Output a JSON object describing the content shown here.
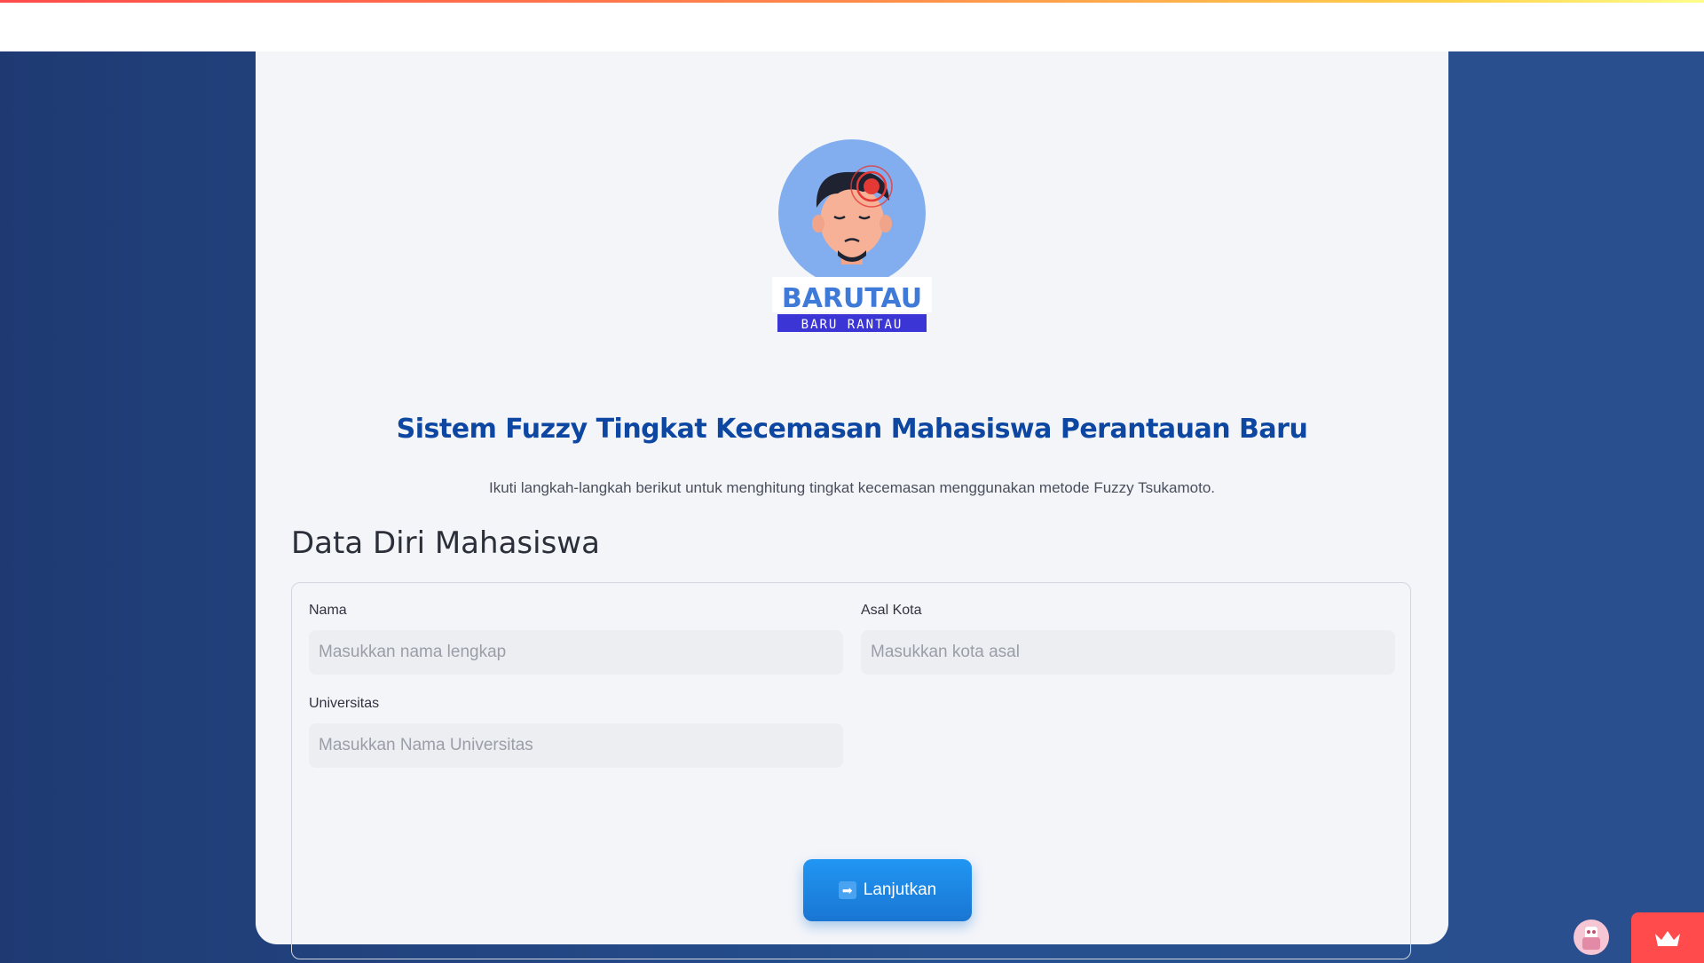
{
  "header": {
    "accent_colors": [
      "#ff4b4b",
      "#ffd24b"
    ]
  },
  "logo": {
    "name": "BARUTAU",
    "tagline": "BARU RANTAU"
  },
  "main": {
    "title": "Sistem Fuzzy Tingkat Kecemasan Mahasiswa Perantauan Baru",
    "subtitle": "Ikuti langkah-langkah berikut untuk menghitung tingkat kecemasan menggunakan metode Fuzzy Tsukamoto.",
    "section_title": "Data Diri Mahasiswa"
  },
  "form": {
    "nama": {
      "label": "Nama",
      "placeholder": "Masukkan nama lengkap",
      "value": ""
    },
    "asal_kota": {
      "label": "Asal Kota",
      "placeholder": "Masukkan kota asal",
      "value": ""
    },
    "universitas": {
      "label": "Universitas",
      "placeholder": "Masukkan Nama Universitas",
      "value": ""
    },
    "submit_icon": "➡",
    "submit_label": "Lanjutkan"
  },
  "colors": {
    "title": "#0d47a1",
    "button": "#1e88e5",
    "background": "#24488a",
    "badge": "#ff4b4b"
  },
  "icons": {
    "submit": "arrow-right-icon",
    "badge": "crown-icon",
    "avatar": "user-avatar-icon"
  }
}
